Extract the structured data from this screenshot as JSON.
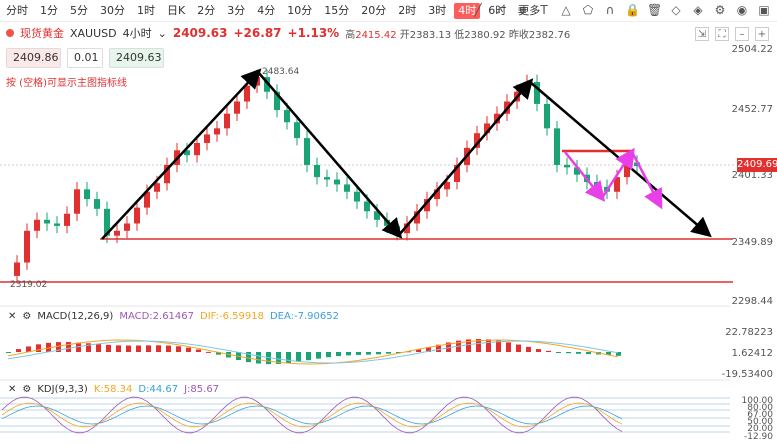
{
  "timeframes": [
    "分时",
    "1分",
    "5分",
    "30分",
    "1时",
    "日K",
    "2分",
    "3分",
    "4分",
    "10分",
    "15分",
    "20分",
    "2时",
    "3时",
    "4时",
    "6时",
    "更多"
  ],
  "active_timeframe": "4时",
  "symbol": {
    "name": "现货黄金",
    "code": "XAUUSD",
    "period": "4小时"
  },
  "quote": {
    "price": "2409.63",
    "change": "+26.87",
    "pct": "+1.13%",
    "high_label": "高",
    "high": "2415.42",
    "open_label": "开",
    "open": "2383.13",
    "low_label": "低",
    "low": "2380.92",
    "prev_label": "昨收",
    "prev": "2382.76"
  },
  "inputs": {
    "sell": "2409.86",
    "lot": "0.01",
    "buy": "2409.63"
  },
  "hint": "按 (空格)可显示主图指标线",
  "price_axis": [
    "2504.22",
    "2452.77",
    "2401.33",
    "2349.89",
    "2298.44"
  ],
  "current_price_tag": "2409.69",
  "annotations": {
    "peak": "2483.64",
    "low": "2319.02"
  },
  "macd": {
    "title": "MACD(12,26,9)",
    "macd": "MACD:2.61467",
    "dif": "DIF:-6.59918",
    "dea": "DEA:-7.90652",
    "axis": [
      "22.78223",
      "1.62412",
      "-19.53400"
    ]
  },
  "kdj": {
    "title": "KDJ(9,3,3)",
    "k": "K:58.34",
    "d": "D:44.67",
    "j": "J:85.67",
    "axis": [
      "100.00",
      "80.00",
      "67.00",
      "50.00",
      "20.00",
      "-12.90"
    ]
  },
  "colors": {
    "up": "#e03030",
    "down": "#1aa376",
    "macd_line": "#f5a623",
    "dea_line": "#7ec8e3"
  },
  "icons": [
    "pen-icon",
    "line-icon",
    "ray-icon",
    "text-icon",
    "ruler-icon",
    "shape-icon",
    "magnet-icon",
    "lock-icon",
    "trash-icon",
    "eraser-icon",
    "layers-icon",
    "settings-icon",
    "eye-icon",
    "screenshot-icon"
  ]
}
